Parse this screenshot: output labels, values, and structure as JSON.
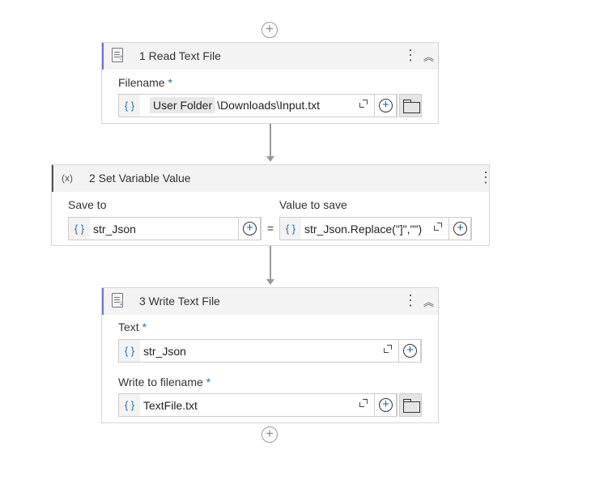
{
  "workflow": {
    "activities": [
      {
        "title": "1 Read Text File",
        "icon": "read-file-icon",
        "fields": [
          {
            "label": "Filename",
            "required_mark": "*",
            "chip": "User Folder",
            "value": "\\Downloads\\Input.txt"
          }
        ]
      },
      {
        "title": "2 Set Variable Value",
        "icon": "variable-icon",
        "icon_text": "(x)",
        "save_to_label": "Save to",
        "save_to_value": "str_Json",
        "equals": "=",
        "value_label": "Value to save",
        "value_value": "str_Json.Replace(\"]\",\"\")"
      },
      {
        "title": "3 Write Text File",
        "icon": "write-file-icon",
        "fields": [
          {
            "label": "Text",
            "required_mark": "*",
            "value": "str_Json"
          },
          {
            "label": "Write to filename",
            "required_mark": "*",
            "value": "TextFile.txt"
          }
        ]
      }
    ],
    "brace_symbol": "{ }",
    "plus_symbol": "+"
  }
}
